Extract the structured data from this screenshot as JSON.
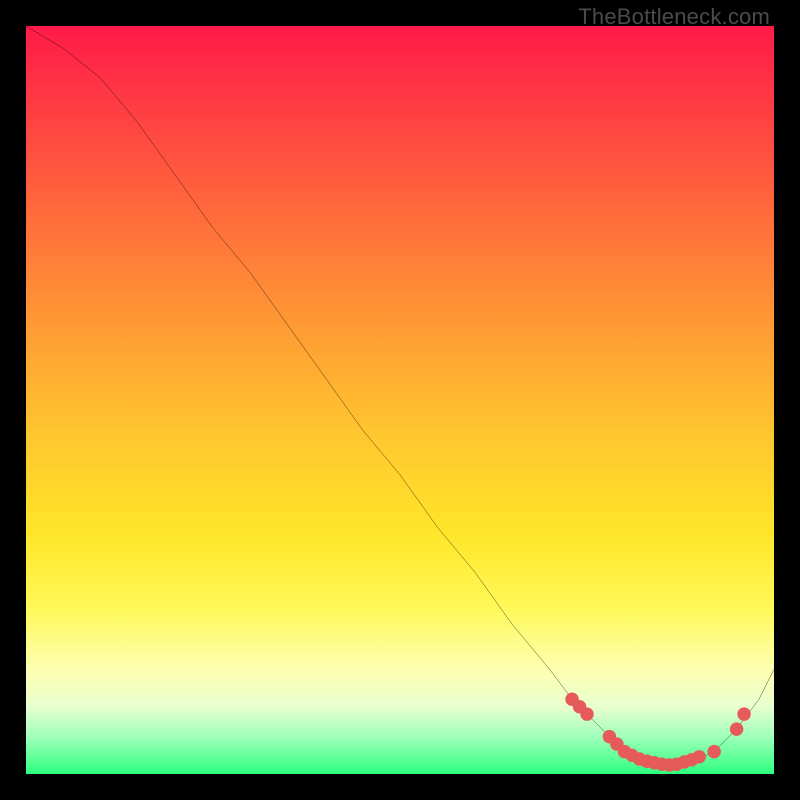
{
  "watermark": "TheBottleneck.com",
  "chart_data": {
    "type": "line",
    "title": "",
    "xlabel": "",
    "ylabel": "",
    "xlim": [
      0,
      100
    ],
    "ylim": [
      0,
      100
    ],
    "grid": false,
    "legend": false,
    "series": [
      {
        "name": "bottleneck-curve",
        "x": [
          0,
          5,
          10,
          15,
          20,
          25,
          30,
          35,
          40,
          45,
          50,
          55,
          60,
          65,
          70,
          73,
          75,
          78,
          80,
          82,
          85,
          88,
          90,
          92,
          95,
          98,
          100
        ],
        "y": [
          100,
          97,
          93,
          87,
          80,
          73,
          67,
          60,
          53,
          46,
          40,
          33,
          27,
          20,
          14,
          10,
          8,
          5,
          3,
          2,
          1,
          1,
          2,
          3,
          6,
          10,
          14
        ]
      }
    ],
    "markers": {
      "name": "highlighted-points",
      "color": "#e65a5a",
      "x": [
        73,
        74,
        75,
        78,
        79,
        80,
        81,
        82,
        83,
        84,
        85,
        86,
        87,
        88,
        89,
        90,
        92,
        95,
        96
      ],
      "y": [
        10,
        9,
        8,
        5,
        4,
        3,
        2.5,
        2,
        1.7,
        1.5,
        1.3,
        1.2,
        1.3,
        1.6,
        1.9,
        2.3,
        3,
        6,
        8
      ]
    }
  }
}
